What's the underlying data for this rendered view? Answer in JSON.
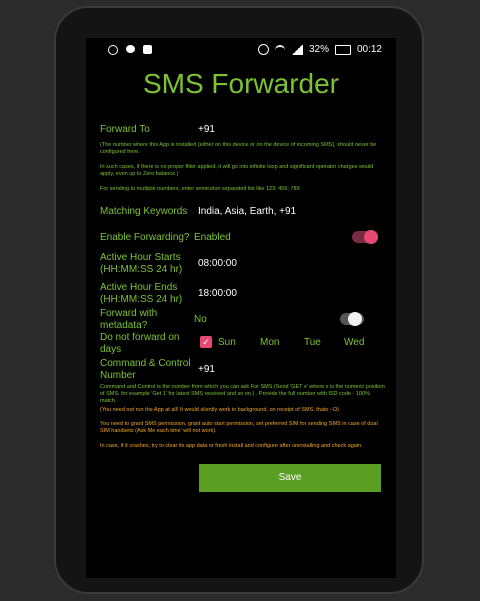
{
  "status": {
    "battery": "32%",
    "time": "00:12"
  },
  "app_title": "SMS Forwarder",
  "forward_to": {
    "label": "Forward To",
    "value": "+91"
  },
  "notes_forward": [
    "(The number where this App is installed (either on this device or on the device of incoming SMS), should never be configured here.",
    "In such cases, if there is no proper filter applied, it will go into infinite loop and significant operator charges would apply, even up to Zero balance.)",
    "For sending to multiple numbers, enter semicolon separated list like 123; 456; 789"
  ],
  "matching_keywords": {
    "label": "Matching Keywords",
    "value": "India, Asia, Earth, +91"
  },
  "enable_forwarding": {
    "label": "Enable Forwarding?",
    "value": "Enabled",
    "on": true
  },
  "active_start": {
    "label": "Active Hour Starts (HH:MM:SS 24 hr)",
    "value": "08:00:00"
  },
  "active_end": {
    "label": "Active Hour Ends (HH:MM:SS 24 hr)",
    "value": "18:00:00"
  },
  "metadata": {
    "label": "Forward with metadata?",
    "value": "No",
    "on": false
  },
  "days": {
    "label": "Do not forward on days",
    "items": [
      {
        "name": "Sun",
        "checked": true
      },
      {
        "name": "Mon",
        "checked": false
      },
      {
        "name": "Tue",
        "checked": false
      },
      {
        "name": "Wed",
        "checked": false
      }
    ]
  },
  "command_control": {
    "label": "Command & Control Number",
    "value": "+91"
  },
  "notes_command": [
    "Command and Control is the number from which you can ask For SMS (Send 'GET x' where x is the numeric position of SMS, for example 'Get 1' for latest SMS received and so on.) . Provide the full number with ISD code - 100% match.",
    "(You need not run the App at all! It would silently work in background, on receipt of SMS. thats :-D)",
    "You need to grant SMS permission, grant auto start permission, set preferred SIM for sending SMS in case of dual SIM handsets (Ask Me each time' will not work).",
    "In case, if it crashes, try to clear its app data or fresh install and configure after uninstalling and check again."
  ],
  "save_label": "Save",
  "colors": {
    "accent": "#7cc334",
    "toggle_on": "#e64a73",
    "save": "#5a9e23",
    "warning": "#f5a623"
  },
  "icons": {
    "status_left": [
      "whatsapp-icon",
      "chat-icon",
      "notification-icon"
    ],
    "status_right": [
      "alarm-icon",
      "wifi-icon",
      "signal-icon",
      "battery-icon"
    ]
  }
}
